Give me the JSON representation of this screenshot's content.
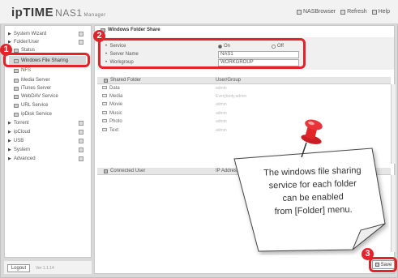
{
  "header": {
    "logo_brand": "ipTIME",
    "logo_product": "NAS1",
    "logo_sub": "Manager",
    "links": [
      {
        "label": "NASBrowser",
        "icon": "browser-icon"
      },
      {
        "label": "Refresh",
        "icon": "refresh-icon"
      },
      {
        "label": "Help",
        "icon": "help-icon"
      }
    ]
  },
  "sidebar": {
    "items": [
      {
        "label": "System Wizard",
        "icon": "arrow-icon"
      },
      {
        "label": "Folder/User",
        "icon": "arrow-icon"
      },
      {
        "label": "Status",
        "icon": "folder-icon"
      },
      {
        "label": "Windows File Sharing",
        "icon": "folder-icon",
        "selected": true
      },
      {
        "label": "NFS",
        "icon": "folder-icon"
      },
      {
        "label": "Media Server",
        "icon": "folder-icon"
      },
      {
        "label": "iTunes Server",
        "icon": "folder-icon"
      },
      {
        "label": "WebDAV Service",
        "icon": "folder-icon"
      },
      {
        "label": "URL Service",
        "icon": "folder-icon"
      },
      {
        "label": "ipDisk Service",
        "icon": "folder-icon"
      },
      {
        "label": "Torrent",
        "icon": "arrow-icon"
      },
      {
        "label": "ipCloud",
        "icon": "arrow-icon"
      },
      {
        "label": "USB",
        "icon": "arrow-icon"
      },
      {
        "label": "System",
        "icon": "arrow-icon"
      },
      {
        "label": "Advanced",
        "icon": "arrow-icon"
      }
    ],
    "logout_label": "Logout",
    "version": "Ver 1.1.14"
  },
  "content": {
    "title": "Windows Folder Share",
    "service_label": "Service",
    "service_on": "On",
    "service_off": "Off",
    "service_value": "On",
    "server_name_label": "Server Name",
    "server_name_value": "NAS1",
    "workgroup_label": "Workgroup",
    "workgroup_value": "WORKGROUP",
    "shared_table": {
      "headers": [
        "Shared Folder",
        "User/Group"
      ],
      "rows": [
        {
          "folder": "Data",
          "user": "admin"
        },
        {
          "folder": "Media",
          "user": "Everybody,admin"
        },
        {
          "folder": "Movie",
          "user": "admin"
        },
        {
          "folder": "Music",
          "user": "admin"
        },
        {
          "folder": "Photo",
          "user": "admin"
        },
        {
          "folder": "Text",
          "user": "admin"
        }
      ]
    },
    "connected_table": {
      "headers": [
        "Connected User",
        "IP Address"
      ]
    },
    "save_label": "Save"
  },
  "annotations": {
    "badges": [
      "1",
      "2",
      "3"
    ],
    "note_lines": [
      "The windows file sharing",
      "service for each folder",
      "can be enabled",
      "from [Folder] menu."
    ],
    "accent_color": "#e02429"
  }
}
